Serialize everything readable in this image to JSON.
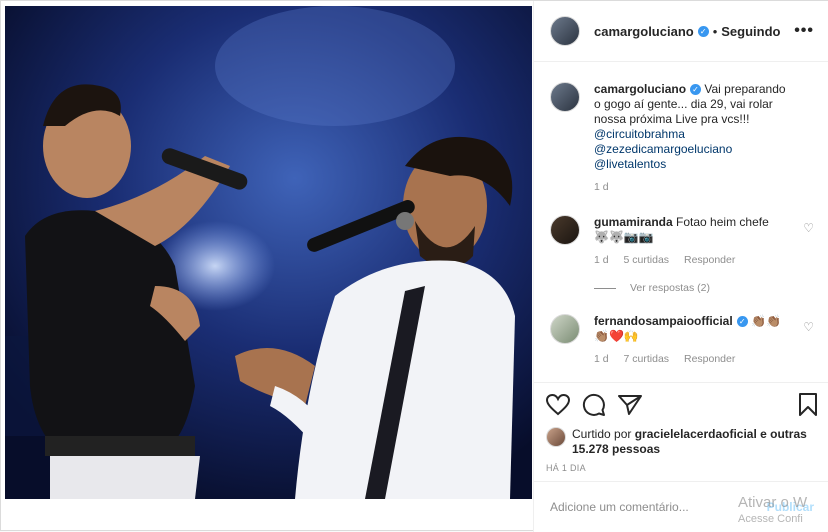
{
  "post": {
    "username": "camargoluciano",
    "follow_status": "Seguindo",
    "more": "•••",
    "caption_text": "Vai preparando o gogo aí gente... dia 29, vai rolar nossa próxima Live pra vcs!!!",
    "mentions": [
      "@circuitobrahma",
      "@zezedicamargoeluciano",
      "@livetalentos"
    ],
    "caption_time": "1 d"
  },
  "comments": [
    {
      "username": "gumamiranda",
      "text": "Fotao heim chefe",
      "emoji": "🐺🐺📷📷",
      "time": "1 d",
      "likes": "5 curtidas",
      "reply": "Responder",
      "view_replies": "Ver respostas (2)"
    },
    {
      "username": "fernandosampaioofficial",
      "emoji_inline": "👏🏽👏🏽",
      "text": "👏🏽❤️🙌",
      "time": "1 d",
      "likes": "7 curtidas",
      "reply": "Responder"
    }
  ],
  "likes": {
    "liked_by_prefix": "Curtido por",
    "liked_by_user": "gracielelacerdaoficial",
    "others": "e outras 15.278 pessoas"
  },
  "time_ago": "HÁ 1 DIA",
  "add_comment": {
    "placeholder": "Adicione um comentário...",
    "publish": "Publicar"
  },
  "watermark": {
    "line1": "Ativar o W",
    "line2": "Acesse Confi"
  },
  "colors": {
    "verified": "#3897f0",
    "link": "#00376b",
    "heart_red": "#ed4956"
  }
}
